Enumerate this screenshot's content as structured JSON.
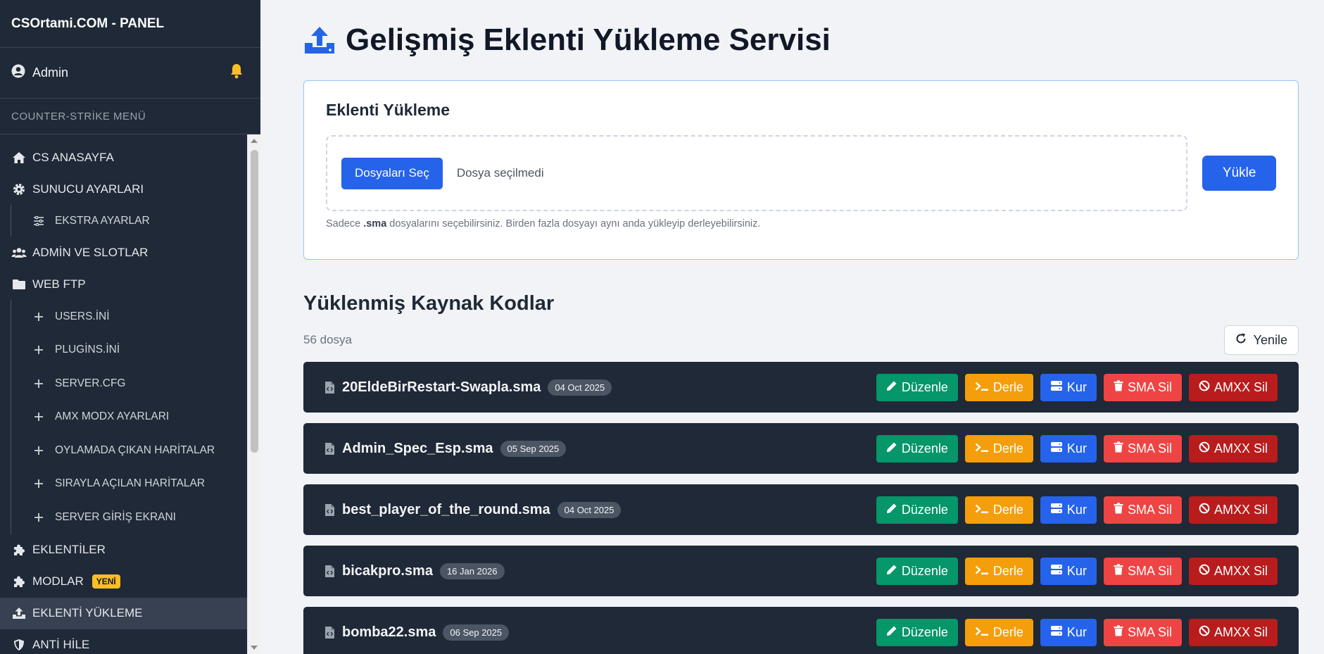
{
  "brand": "CSOrtami.COM - PANEL",
  "user": {
    "name": "Admin"
  },
  "sidebar": {
    "section_title": "COUNTER-STRİKE MENÜ",
    "items": [
      {
        "label": "CS ANASAYFA",
        "icon": "home-icon"
      },
      {
        "label": "SUNUCU AYARLARI",
        "icon": "gear-icon"
      },
      {
        "label": "EKSTRA AYARLAR",
        "icon": "sliders-icon"
      },
      {
        "label": "ADMİN VE SLOTLAR",
        "icon": "users-icon"
      },
      {
        "label": "WEB FTP",
        "icon": "folder-icon"
      },
      {
        "label": "USERS.İNİ",
        "icon": "plus-icon"
      },
      {
        "label": "PLUGİNS.İNİ",
        "icon": "plus-icon"
      },
      {
        "label": "SERVER.CFG",
        "icon": "plus-icon"
      },
      {
        "label": "AMX MODX AYARLARI",
        "icon": "plus-icon"
      },
      {
        "label": "OYLAMADA ÇIKAN HARİTALAR",
        "icon": "plus-icon"
      },
      {
        "label": "SIRAYLA AÇILAN HARİTALAR",
        "icon": "plus-icon"
      },
      {
        "label": "SERVER GİRİŞ EKRANI",
        "icon": "plus-icon"
      },
      {
        "label": "EKLENTİLER",
        "icon": "puzzle-icon"
      },
      {
        "label": "MODLAR",
        "icon": "puzzle-icon",
        "badge": "YENİ"
      },
      {
        "label": "EKLENTİ YÜKLEME",
        "icon": "upload-icon"
      },
      {
        "label": "ANTİ HİLE",
        "icon": "shield-icon"
      }
    ]
  },
  "main": {
    "title": "Gelişmiş Eklenti Yükleme Servisi",
    "upload": {
      "heading": "Eklenti Yükleme",
      "choose_label": "Dosyaları Seç",
      "no_file": "Dosya seçilmedi",
      "upload_label": "Yükle",
      "hint_prefix": "Sadece ",
      "hint_ext": ".sma",
      "hint_suffix": " dosyalarını seçebilirsiniz. Birden fazla dosyayı aynı anda yükleyip derleyebilirsiniz."
    },
    "list": {
      "heading": "Yüklenmiş Kaynak Kodlar",
      "count": "56 dosya",
      "refresh_label": "Yenile",
      "actions": {
        "edit": "Düzenle",
        "compile": "Derle",
        "install": "Kur",
        "delete_sma": "SMA Sil",
        "delete_amxx": "AMXX Sil"
      },
      "files": [
        {
          "name": "20EldeBirRestart-Swapla.sma",
          "date": "04 Oct 2025"
        },
        {
          "name": "Admin_Spec_Esp.sma",
          "date": "05 Sep 2025"
        },
        {
          "name": "best_player_of_the_round.sma",
          "date": "04 Oct 2025"
        },
        {
          "name": "bicakpro.sma",
          "date": "16 Jan 2026"
        },
        {
          "name": "bomba22.sma",
          "date": "06 Sep 2025"
        }
      ]
    }
  },
  "colors": {
    "sidebar_bg": "#1f2937",
    "primary": "#2563eb",
    "edit": "#059669",
    "compile": "#f59e0b",
    "delete_sma": "#ef4444",
    "delete_amxx": "#b91c1c",
    "badge_new": "#fbbf24",
    "bell": "#fbbf24"
  }
}
